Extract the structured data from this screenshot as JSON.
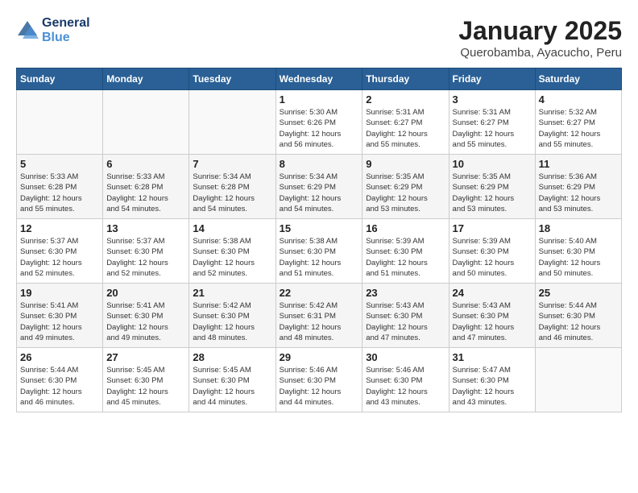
{
  "header": {
    "logo_line1": "General",
    "logo_line2": "Blue",
    "month_year": "January 2025",
    "location": "Querobamba, Ayacucho, Peru"
  },
  "days_of_week": [
    "Sunday",
    "Monday",
    "Tuesday",
    "Wednesday",
    "Thursday",
    "Friday",
    "Saturday"
  ],
  "weeks": [
    [
      {
        "day": "",
        "info": ""
      },
      {
        "day": "",
        "info": ""
      },
      {
        "day": "",
        "info": ""
      },
      {
        "day": "1",
        "info": "Sunrise: 5:30 AM\nSunset: 6:26 PM\nDaylight: 12 hours\nand 56 minutes."
      },
      {
        "day": "2",
        "info": "Sunrise: 5:31 AM\nSunset: 6:27 PM\nDaylight: 12 hours\nand 55 minutes."
      },
      {
        "day": "3",
        "info": "Sunrise: 5:31 AM\nSunset: 6:27 PM\nDaylight: 12 hours\nand 55 minutes."
      },
      {
        "day": "4",
        "info": "Sunrise: 5:32 AM\nSunset: 6:27 PM\nDaylight: 12 hours\nand 55 minutes."
      }
    ],
    [
      {
        "day": "5",
        "info": "Sunrise: 5:33 AM\nSunset: 6:28 PM\nDaylight: 12 hours\nand 55 minutes."
      },
      {
        "day": "6",
        "info": "Sunrise: 5:33 AM\nSunset: 6:28 PM\nDaylight: 12 hours\nand 54 minutes."
      },
      {
        "day": "7",
        "info": "Sunrise: 5:34 AM\nSunset: 6:28 PM\nDaylight: 12 hours\nand 54 minutes."
      },
      {
        "day": "8",
        "info": "Sunrise: 5:34 AM\nSunset: 6:29 PM\nDaylight: 12 hours\nand 54 minutes."
      },
      {
        "day": "9",
        "info": "Sunrise: 5:35 AM\nSunset: 6:29 PM\nDaylight: 12 hours\nand 53 minutes."
      },
      {
        "day": "10",
        "info": "Sunrise: 5:35 AM\nSunset: 6:29 PM\nDaylight: 12 hours\nand 53 minutes."
      },
      {
        "day": "11",
        "info": "Sunrise: 5:36 AM\nSunset: 6:29 PM\nDaylight: 12 hours\nand 53 minutes."
      }
    ],
    [
      {
        "day": "12",
        "info": "Sunrise: 5:37 AM\nSunset: 6:30 PM\nDaylight: 12 hours\nand 52 minutes."
      },
      {
        "day": "13",
        "info": "Sunrise: 5:37 AM\nSunset: 6:30 PM\nDaylight: 12 hours\nand 52 minutes."
      },
      {
        "day": "14",
        "info": "Sunrise: 5:38 AM\nSunset: 6:30 PM\nDaylight: 12 hours\nand 52 minutes."
      },
      {
        "day": "15",
        "info": "Sunrise: 5:38 AM\nSunset: 6:30 PM\nDaylight: 12 hours\nand 51 minutes."
      },
      {
        "day": "16",
        "info": "Sunrise: 5:39 AM\nSunset: 6:30 PM\nDaylight: 12 hours\nand 51 minutes."
      },
      {
        "day": "17",
        "info": "Sunrise: 5:39 AM\nSunset: 6:30 PM\nDaylight: 12 hours\nand 50 minutes."
      },
      {
        "day": "18",
        "info": "Sunrise: 5:40 AM\nSunset: 6:30 PM\nDaylight: 12 hours\nand 50 minutes."
      }
    ],
    [
      {
        "day": "19",
        "info": "Sunrise: 5:41 AM\nSunset: 6:30 PM\nDaylight: 12 hours\nand 49 minutes."
      },
      {
        "day": "20",
        "info": "Sunrise: 5:41 AM\nSunset: 6:30 PM\nDaylight: 12 hours\nand 49 minutes."
      },
      {
        "day": "21",
        "info": "Sunrise: 5:42 AM\nSunset: 6:30 PM\nDaylight: 12 hours\nand 48 minutes."
      },
      {
        "day": "22",
        "info": "Sunrise: 5:42 AM\nSunset: 6:31 PM\nDaylight: 12 hours\nand 48 minutes."
      },
      {
        "day": "23",
        "info": "Sunrise: 5:43 AM\nSunset: 6:30 PM\nDaylight: 12 hours\nand 47 minutes."
      },
      {
        "day": "24",
        "info": "Sunrise: 5:43 AM\nSunset: 6:30 PM\nDaylight: 12 hours\nand 47 minutes."
      },
      {
        "day": "25",
        "info": "Sunrise: 5:44 AM\nSunset: 6:30 PM\nDaylight: 12 hours\nand 46 minutes."
      }
    ],
    [
      {
        "day": "26",
        "info": "Sunrise: 5:44 AM\nSunset: 6:30 PM\nDaylight: 12 hours\nand 46 minutes."
      },
      {
        "day": "27",
        "info": "Sunrise: 5:45 AM\nSunset: 6:30 PM\nDaylight: 12 hours\nand 45 minutes."
      },
      {
        "day": "28",
        "info": "Sunrise: 5:45 AM\nSunset: 6:30 PM\nDaylight: 12 hours\nand 44 minutes."
      },
      {
        "day": "29",
        "info": "Sunrise: 5:46 AM\nSunset: 6:30 PM\nDaylight: 12 hours\nand 44 minutes."
      },
      {
        "day": "30",
        "info": "Sunrise: 5:46 AM\nSunset: 6:30 PM\nDaylight: 12 hours\nand 43 minutes."
      },
      {
        "day": "31",
        "info": "Sunrise: 5:47 AM\nSunset: 6:30 PM\nDaylight: 12 hours\nand 43 minutes."
      },
      {
        "day": "",
        "info": ""
      }
    ]
  ]
}
